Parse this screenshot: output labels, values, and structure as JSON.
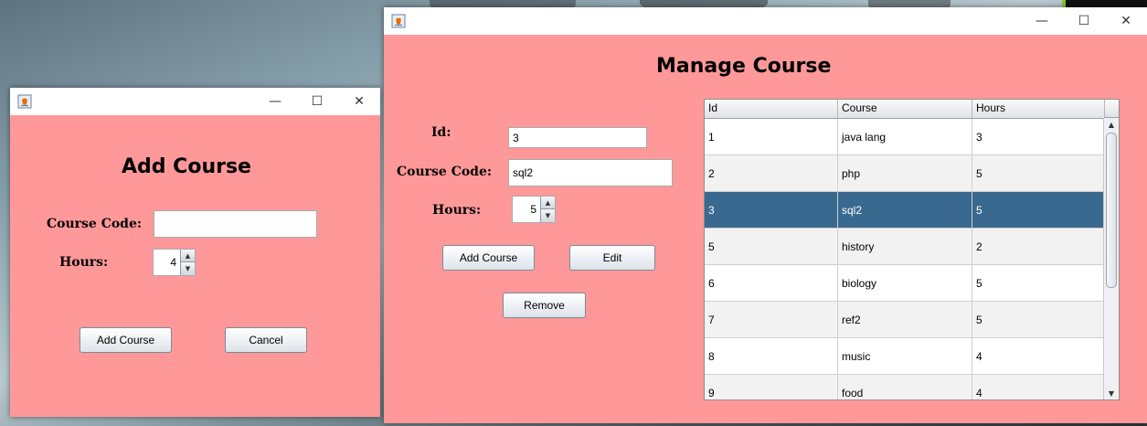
{
  "add_window": {
    "heading": "Add Course",
    "course_code_label": "Course Code:",
    "course_code_value": "",
    "hours_label": "Hours:",
    "hours_value": "4",
    "add_button": "Add Course",
    "cancel_button": "Cancel",
    "controls": {
      "minimize": "—",
      "maximize": "☐",
      "close": "✕"
    }
  },
  "manage_window": {
    "heading": "Manage Course",
    "id_label": "Id:",
    "id_value": "3",
    "course_code_label": "Course Code:",
    "course_code_value": "sql2",
    "hours_label": "Hours:",
    "hours_value": "5",
    "add_button": "Add Course",
    "edit_button": "Edit",
    "remove_button": "Remove",
    "controls": {
      "minimize": "—",
      "maximize": "☐",
      "close": "✕"
    },
    "table": {
      "columns": [
        "Id",
        "Course",
        "Hours"
      ],
      "rows": [
        [
          "1",
          "java lang",
          "3"
        ],
        [
          "2",
          "php",
          "5"
        ],
        [
          "3",
          "sql2",
          "5"
        ],
        [
          "5",
          "history",
          "2"
        ],
        [
          "6",
          "biology",
          "5"
        ],
        [
          "7",
          "ref2",
          "5"
        ],
        [
          "8",
          "music",
          "4"
        ],
        [
          "9",
          "food",
          "4"
        ]
      ],
      "selected_row_index": 2
    }
  },
  "colors": {
    "window_bg": "#ff9999",
    "selected_row": "#39698f"
  },
  "icons": {
    "app_icon": "java-coffee-icon",
    "spin_up": "▲",
    "spin_down": "▼",
    "scroll_up": "▲",
    "scroll_down": "▼"
  }
}
